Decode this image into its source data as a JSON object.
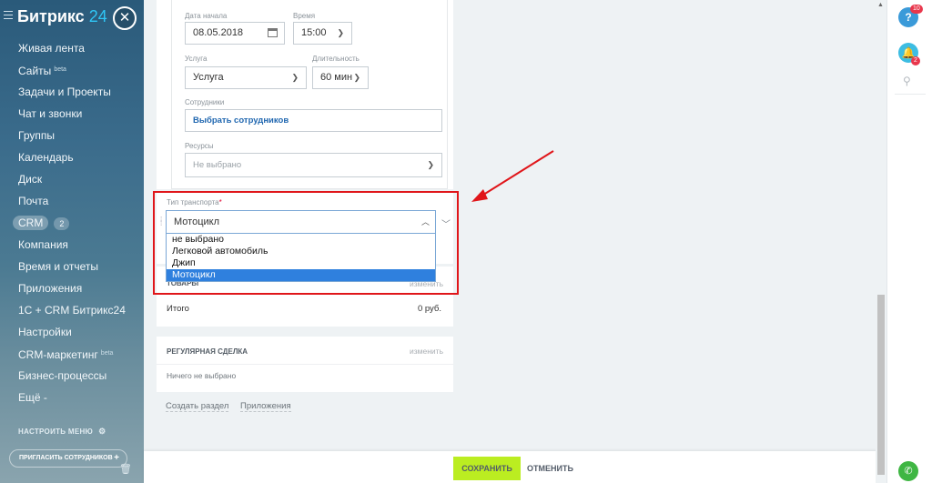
{
  "sidebar": {
    "logo_name": "Битрикс",
    "logo_num": "24",
    "close_icon": "✕",
    "items": [
      {
        "label": "Живая лента"
      },
      {
        "label": "Сайты",
        "sup": "beta"
      },
      {
        "label": "Задачи и Проекты"
      },
      {
        "label": "Чат и звонки"
      },
      {
        "label": "Группы"
      },
      {
        "label": "Календарь"
      },
      {
        "label": "Диск"
      },
      {
        "label": "Почта"
      },
      {
        "label": "CRM",
        "count": "2"
      },
      {
        "label": "Компания"
      },
      {
        "label": "Время и отчеты"
      },
      {
        "label": "Приложения"
      },
      {
        "label": "1С + CRM Битрикс24"
      },
      {
        "label": "Настройки"
      },
      {
        "label": "CRM-маркетинг",
        "sup": "beta"
      },
      {
        "label": "Бизнес-процессы"
      },
      {
        "label": "Ещё -"
      }
    ],
    "settings_label": "НАСТРОИТЬ МЕНЮ",
    "invite_label": "ПРИГЛАСИТЬ СОТРУДНИКОВ",
    "invite_plus": "+"
  },
  "form": {
    "date_label": "Дата начала",
    "date_value": "08.05.2018",
    "time_label": "Время",
    "time_value": "15:00",
    "service_label": "Услуга",
    "service_value": "Услуга",
    "duration_label": "Длительность",
    "duration_value": "60 мин",
    "staff_label": "Сотрудники",
    "staff_link": "Выбрать сотрудников",
    "resources_label": "Ресурсы",
    "resources_placeholder": "Не выбрано",
    "transport_label": "Тип транспорта",
    "transport_required": "*",
    "transport_value": "Мотоцикл",
    "transport_options": [
      "не выбрано",
      "Легковой автомобиль",
      "Джип",
      "Мотоцикл"
    ],
    "transport_selected_index": 3
  },
  "products": {
    "heading": "ТОВАРЫ",
    "change": "изменить",
    "total_label": "Итого",
    "total_value": "0 руб."
  },
  "regular_deal": {
    "heading": "РЕГУЛЯРНАЯ СДЕЛКА",
    "change": "изменить",
    "empty": "Ничего не выбрано"
  },
  "links": {
    "create_section": "Создать раздел",
    "apps": "Приложения"
  },
  "footer": {
    "save": "СОХРАНИТЬ",
    "cancel": "ОТМЕНИТЬ"
  },
  "right_panel": {
    "help_badge": "10",
    "bell_badge": "2",
    "help_glyph": "?",
    "bell_glyph": "🔔",
    "search_glyph": "⚲",
    "phone_glyph": "✆"
  },
  "colors": {
    "save_button": "#bbed21",
    "highlight": "#e0161a",
    "selected_option": "#2f80de",
    "link": "#2067b0"
  }
}
